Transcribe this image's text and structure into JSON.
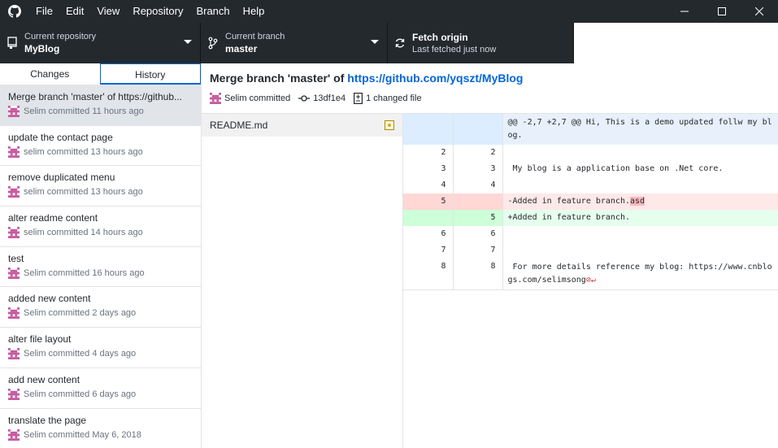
{
  "menu": {
    "items": [
      {
        "label": "File"
      },
      {
        "label": "Edit"
      },
      {
        "label": "View"
      },
      {
        "label": "Repository"
      },
      {
        "label": "Branch"
      },
      {
        "label": "Help"
      }
    ]
  },
  "toolbar": {
    "repo_label": "Current repository",
    "repo_value": "MyBlog",
    "branch_label": "Current branch",
    "branch_value": "master",
    "fetch_label": "Fetch origin",
    "fetch_sub": "Last fetched just now"
  },
  "tabs": {
    "changes": "Changes",
    "history": "History"
  },
  "commits": [
    {
      "summary": "Merge branch 'master' of https://github...",
      "meta": "Selim committed 11 hours ago"
    },
    {
      "summary": "update the contact page",
      "meta": "selim committed 13 hours ago"
    },
    {
      "summary": "remove duplicated menu",
      "meta": "selim committed 13 hours ago"
    },
    {
      "summary": "alter readme content",
      "meta": "selim committed 14 hours ago"
    },
    {
      "summary": "test",
      "meta": "Selim committed 16 hours ago"
    },
    {
      "summary": "added new content",
      "meta": "Selim committed 2 days ago"
    },
    {
      "summary": "alter file layout",
      "meta": "Selim committed 4 days ago"
    },
    {
      "summary": "add new content",
      "meta": "Selim committed 6 days ago"
    },
    {
      "summary": "translate the page",
      "meta": "Selim committed May 6, 2018"
    }
  ],
  "commit_detail": {
    "title_prefix": "Merge branch 'master' of ",
    "title_link": "https://github.com/yqszt/MyBlog",
    "author": "Selim committed",
    "sha": "13df1e4",
    "changed": "1 changed file"
  },
  "files": [
    {
      "name": "README.md"
    }
  ],
  "diff": {
    "hunk": "@@ -2,7 +2,7 @@ Hi, This is a demo updated follw my blog.",
    "rows": [
      {
        "old": "2",
        "new": "2",
        "text": ""
      },
      {
        "old": "3",
        "new": "3",
        "text": " My blog is a application base on .Net core."
      },
      {
        "old": "4",
        "new": "4",
        "text": ""
      },
      {
        "old": "5",
        "new": "",
        "text": "-Added in feature branch.",
        "highlight": "asd"
      },
      {
        "old": "",
        "new": "5",
        "text": "+Added in feature branch."
      },
      {
        "old": "6",
        "new": "6",
        "text": ""
      },
      {
        "old": "7",
        "new": "7",
        "text": ""
      },
      {
        "old": "8",
        "new": "8",
        "text": " For more details reference my blog: https://www.cnblogs.com/selimsong"
      }
    ]
  },
  "colors": {
    "titlebar": "#24292e",
    "link": "#0366d6",
    "deleted": "#ffe8e8",
    "added": "#e6ffed"
  }
}
